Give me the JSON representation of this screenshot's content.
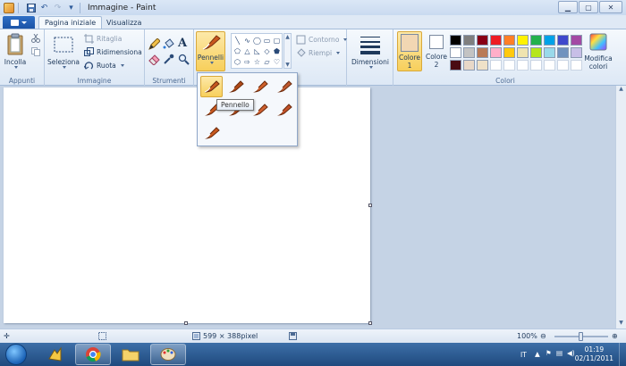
{
  "window": {
    "title": "Immagine - Paint",
    "minimize": "▁",
    "maximize": "▢",
    "close": "✕"
  },
  "tabs": [
    {
      "label": "Pagina iniziale"
    },
    {
      "label": "Visualizza"
    }
  ],
  "ribbon": {
    "clipboard": {
      "label": "Appunti",
      "paste": "Incolla"
    },
    "image": {
      "label": "Immagine",
      "select": "Seleziona",
      "crop": "Ritaglia",
      "resize": "Ridimensiona",
      "rotate": "Ruota"
    },
    "tools": {
      "label": "Strumenti"
    },
    "brushes": {
      "label": "Pennelli"
    },
    "shapes": {
      "outline": "Contorno",
      "fill": "Riempi"
    },
    "size": {
      "label": "Dimensioni"
    },
    "colors": {
      "label": "Colori",
      "color1": "Colore 1",
      "color2": "Colore 2",
      "edit": "Modifica colori",
      "color1_value": "#f2d7b3",
      "color2_value": "#ffffff",
      "palette": [
        "#000000",
        "#7f7f7f",
        "#880015",
        "#ed1c24",
        "#ff7f27",
        "#fff200",
        "#22b14c",
        "#00a2e8",
        "#3f48cc",
        "#a349a4",
        "#ffffff",
        "#c3c3c3",
        "#b97a57",
        "#ffaec9",
        "#ffc90e",
        "#efe4b0",
        "#b5e61d",
        "#99d9ea",
        "#7092be",
        "#c8bfe7",
        "#4a0b12",
        "#e8d8c8",
        "#efe1c8",
        "",
        "",
        "",
        "",
        "",
        "",
        ""
      ]
    }
  },
  "brush_menu": {
    "tooltip": "Pennello",
    "items": [
      "b1",
      "b2",
      "b3",
      "b4",
      "b5",
      "b6",
      "b7",
      "b8",
      "b9"
    ]
  },
  "status": {
    "dimensions": "599 × 388pixel",
    "zoom": "100%",
    "zoom_fraction": 0.5
  },
  "taskbar": {
    "lang": "IT",
    "time": "01:19",
    "date": "02/11/2011"
  }
}
